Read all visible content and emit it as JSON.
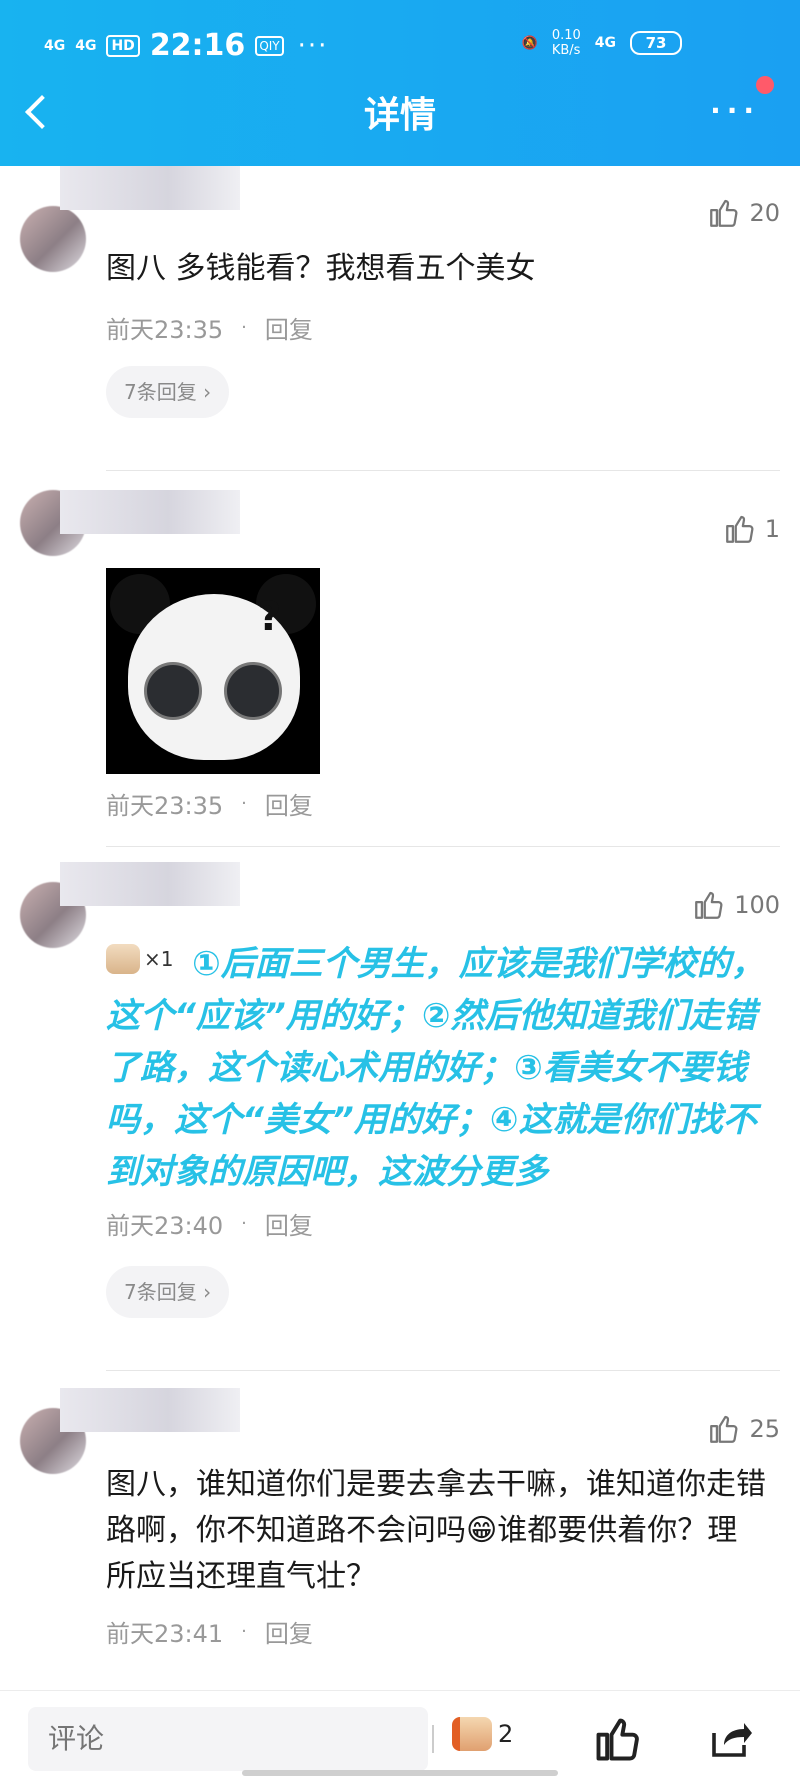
{
  "status_bar": {
    "signal1": "4G",
    "signal2": "4G",
    "hd": "HD",
    "time": "22:16",
    "app": "QIY",
    "dots": "···",
    "speed": "0.10",
    "speed_unit": "KB/s",
    "net": "4G",
    "battery": "73"
  },
  "nav": {
    "title": "详情",
    "more": "···"
  },
  "comments": [
    {
      "likes": "20",
      "text": "图八 多钱能看？我想看五个美女",
      "time": "前天23:35",
      "reply": "回复",
      "replies": "7条回复"
    },
    {
      "likes": "1",
      "time": "前天23:35",
      "reply": "回复"
    },
    {
      "likes": "100",
      "badge_count": "×1",
      "text": "①后面三个男生，应该是我们学校的，这个“应该”用的好；②然后他知道我们走错了路，这个读心术用的好；③看美女不要钱吗，这个“美女”用的好；④这就是你们找不到对象的原因吧，这波分更多",
      "time": "前天23:40",
      "reply": "回复",
      "replies": "7条回复"
    },
    {
      "likes": "25",
      "text": "图八，谁知道你们是要去拿去干嘛，谁知道你走错路啊，你不知道路不会问吗😁谁都要供着你？理所应当还理直气壮？",
      "time": "前天23:41",
      "reply": "回复"
    }
  ],
  "bottom_bar": {
    "comment_placeholder": "评论",
    "gift_count": "2"
  },
  "colors": {
    "header": "#18b3f0",
    "highlight_text": "#27c1e6"
  }
}
